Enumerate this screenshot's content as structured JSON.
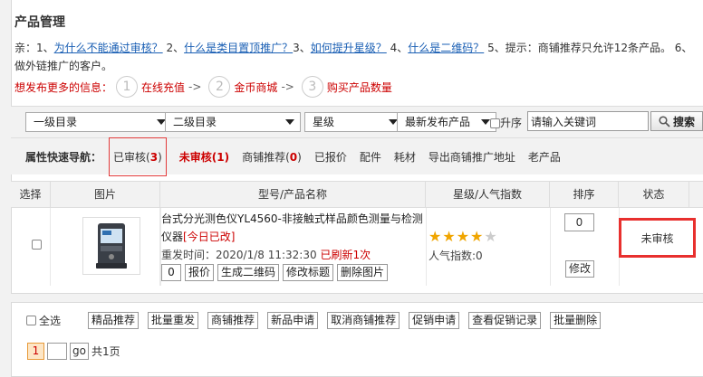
{
  "page": {
    "title": "产品管理"
  },
  "tips": {
    "line1_prefix": "亲：1、",
    "q1": "为什么不能通过审核？",
    "sep2": " 2、",
    "q2": "什么是类目置顶推广？",
    "sep3": "3、",
    "q3": "如何提升星级？",
    "sep4": " 4、",
    "q4": "什么是二维码？",
    "tail": " 5、提示：商铺推荐只允许12条产品。 6、",
    "line2": "做外链推广的客户。"
  },
  "promo": {
    "lead": "想发布更多的信息：",
    "steps": [
      {
        "num": "1",
        "label": "在线充值"
      },
      {
        "num": "2",
        "label": "金币商城"
      },
      {
        "num": "3",
        "label": "购买产品数量"
      }
    ],
    "arrow": "->"
  },
  "filters": {
    "cat1": "一级目录",
    "cat2": "二级目录",
    "star": "星级",
    "sort": "最新发布产品",
    "asc_label": "升序",
    "keyword_value": "请输入关键词",
    "search_label": "搜索"
  },
  "quicknav": {
    "label": "属性快速导航：",
    "items": [
      {
        "text": "已审核(",
        "count": "3",
        "close": ")"
      },
      {
        "text": "未审核(1)"
      },
      {
        "text": "商铺推荐(",
        "count": "0",
        "close": ")"
      },
      {
        "text": "已报价"
      },
      {
        "text": "配件"
      },
      {
        "text": "耗材"
      },
      {
        "text": "导出商铺推广地址"
      },
      {
        "text": "老产品"
      }
    ]
  },
  "table": {
    "headers": [
      "选择",
      "图片",
      "型号/产品名称",
      "星级/人气指数",
      "排序",
      "状态"
    ],
    "rows": [
      {
        "name": "台式分光测色仪YL4560-非接触式样品颜色测量与检测仪器",
        "tag": "[今日已改]",
        "time_label": "重发时间：",
        "time": "2020/1/8 11:32:30",
        "refresh": "已刷新1次",
        "ops_input": "0",
        "ops": [
          "报价",
          "生成二维码",
          "修改标题",
          "删除图片"
        ],
        "stars": 4,
        "stars_max": 5,
        "popularity": "人气指数:0",
        "sort": "0",
        "edit": "修改",
        "status": "未审核"
      }
    ]
  },
  "bulk": {
    "select_all": "全选",
    "buttons": [
      "精品推荐",
      "批量重发",
      "商铺推荐",
      "新品申请",
      "取消商铺推荐",
      "促销申请",
      "查看促销记录",
      "批量删除"
    ]
  },
  "pager": {
    "current": "1",
    "go": "go",
    "total": "共1页"
  }
}
